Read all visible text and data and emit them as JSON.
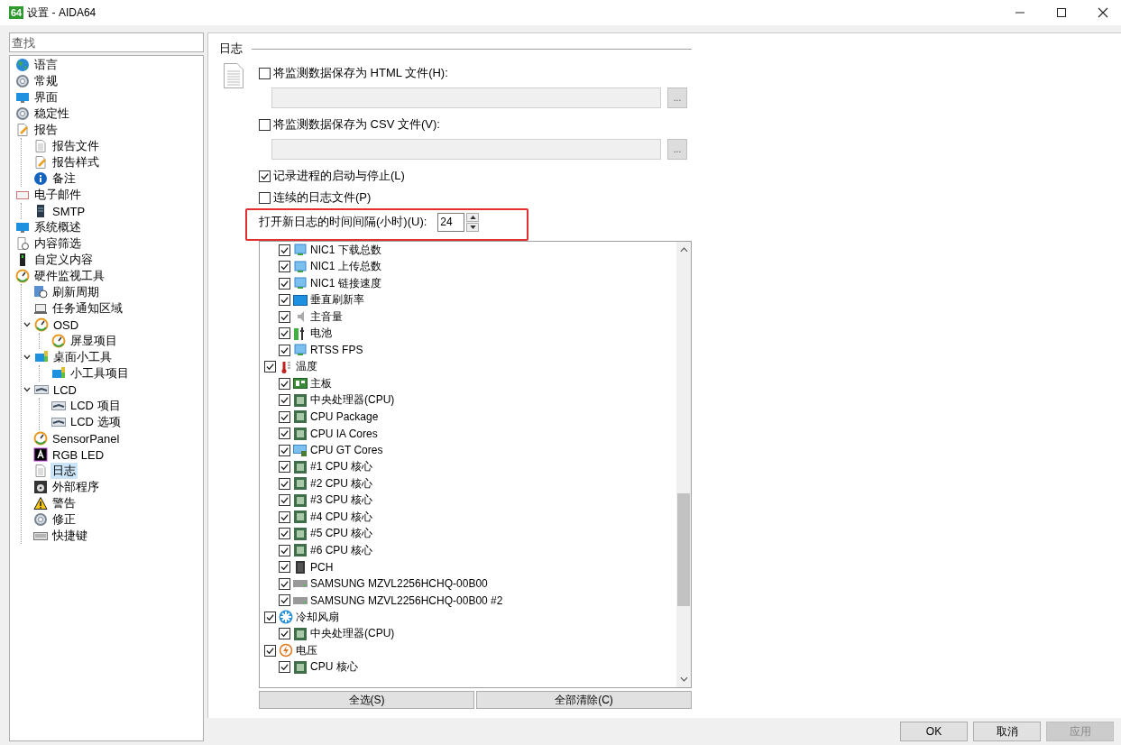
{
  "window": {
    "title": "设置 - AIDA64",
    "app_badge": "64"
  },
  "sidebar": {
    "search": {
      "placeholder": "查找"
    },
    "items": [
      {
        "label": "语言",
        "kind": "globe",
        "selected": false
      },
      {
        "label": "常规",
        "kind": "gear",
        "selected": false
      },
      {
        "label": "界面",
        "kind": "monitor",
        "selected": false
      },
      {
        "label": "稳定性",
        "kind": "gear",
        "selected": false
      },
      {
        "label": "报告",
        "kind": "docpen",
        "selected": false,
        "children": [
          {
            "label": "报告文件",
            "kind": "doc",
            "selected": false
          },
          {
            "label": "报告样式",
            "kind": "docpen",
            "selected": false
          },
          {
            "label": "备注",
            "kind": "info",
            "selected": false
          }
        ]
      },
      {
        "label": "电子邮件",
        "kind": "mail",
        "selected": false,
        "children": [
          {
            "label": "SMTP",
            "kind": "server",
            "selected": false
          }
        ]
      },
      {
        "label": "系统概述",
        "kind": "monitor",
        "selected": false
      },
      {
        "label": "内容筛选",
        "kind": "docclock",
        "selected": false
      },
      {
        "label": "自定义内容",
        "kind": "device",
        "selected": false
      },
      {
        "label": "硬件监视工具",
        "kind": "gauge",
        "selected": false,
        "children": [
          {
            "label": "刷新周期",
            "kind": "clock",
            "selected": false
          },
          {
            "label": "任务通知区域",
            "kind": "taskbar",
            "selected": false
          },
          {
            "label": "OSD",
            "kind": "gauge",
            "selected": false,
            "expanded": true,
            "children": [
              {
                "label": "屏显项目",
                "kind": "gauge",
                "selected": false
              }
            ]
          },
          {
            "label": "桌面小工具",
            "kind": "gadget",
            "selected": false,
            "expanded": true,
            "children": [
              {
                "label": "小工具项目",
                "kind": "gadget",
                "selected": false
              }
            ]
          },
          {
            "label": "LCD",
            "kind": "lcd",
            "selected": false,
            "expanded": true,
            "children": [
              {
                "label": "LCD 项目",
                "kind": "lcd",
                "selected": false
              },
              {
                "label": "LCD 选项",
                "kind": "lcd",
                "selected": false
              }
            ]
          },
          {
            "label": "SensorPanel",
            "kind": "gauge",
            "selected": false
          },
          {
            "label": "RGB LED",
            "kind": "rgb",
            "selected": false
          },
          {
            "label": "日志",
            "kind": "doc",
            "selected": true
          },
          {
            "label": "外部程序",
            "kind": "disc",
            "selected": false
          },
          {
            "label": "警告",
            "kind": "warning",
            "selected": false
          },
          {
            "label": "修正",
            "kind": "gear",
            "selected": false
          },
          {
            "label": "快捷键",
            "kind": "keyboard",
            "selected": false
          }
        ]
      }
    ]
  },
  "log_page": {
    "heading": "日志",
    "options": [
      {
        "kind": "file",
        "label": "将监测数据保存为 HTML 文件(H):",
        "checked": false,
        "browse": "..."
      },
      {
        "kind": "file",
        "label": "将监测数据保存为 CSV 文件(V):",
        "checked": false,
        "browse": "..."
      },
      {
        "kind": "check",
        "label": "记录进程的启动与停止(L)",
        "checked": true
      },
      {
        "kind": "check",
        "label": "连续的日志文件(P)",
        "checked": false
      }
    ],
    "interval": {
      "label": "打开新日志的时间间隔(小时)(U):",
      "value": "24"
    },
    "sensor_list": {
      "groups": [
        {
          "children": [
            {
              "label": "NIC1 下载总数",
              "kind": "net",
              "checked": true
            },
            {
              "label": "NIC1 上传总数",
              "kind": "net",
              "checked": true
            },
            {
              "label": "NIC1 链接速度",
              "kind": "net",
              "checked": true
            },
            {
              "label": "垂直刷新率",
              "kind": "screen",
              "checked": true
            },
            {
              "label": "主音量",
              "kind": "speaker",
              "checked": true
            },
            {
              "label": "电池",
              "kind": "battery",
              "checked": true
            },
            {
              "label": "RTSS FPS",
              "kind": "net",
              "checked": true
            }
          ]
        },
        {
          "label": "温度",
          "kind": "thermo",
          "checked": true,
          "children": [
            {
              "label": "主板",
              "kind": "board",
              "checked": true
            },
            {
              "label": "中央处理器(CPU)",
              "kind": "chip",
              "checked": true
            },
            {
              "label": "CPU Package",
              "kind": "chip",
              "checked": true
            },
            {
              "label": "CPU IA Cores",
              "kind": "chip",
              "checked": true
            },
            {
              "label": "CPU GT Cores",
              "kind": "gpu",
              "checked": true
            },
            {
              "label": "#1 CPU 核心",
              "kind": "chip",
              "checked": true
            },
            {
              "label": "#2 CPU 核心",
              "kind": "chip",
              "checked": true
            },
            {
              "label": "#3 CPU 核心",
              "kind": "chip",
              "checked": true
            },
            {
              "label": "#4 CPU 核心",
              "kind": "chip",
              "checked": true
            },
            {
              "label": "#5 CPU 核心",
              "kind": "chip",
              "checked": true
            },
            {
              "label": "#6 CPU 核心",
              "kind": "chip",
              "checked": true
            },
            {
              "label": "PCH",
              "kind": "pch",
              "checked": true
            },
            {
              "label": "SAMSUNG MZVL2256HCHQ-00B00",
              "kind": "drive",
              "checked": true
            },
            {
              "label": "SAMSUNG MZVL2256HCHQ-00B00 #2",
              "kind": "drive",
              "checked": true
            }
          ]
        },
        {
          "label": "冷却风扇",
          "kind": "fan",
          "checked": true,
          "children": [
            {
              "label": "中央处理器(CPU)",
              "kind": "chip",
              "checked": true
            }
          ]
        },
        {
          "label": "电压",
          "kind": "bolt",
          "checked": true,
          "children": [
            {
              "label": "CPU 核心",
              "kind": "chip",
              "checked": true
            }
          ]
        }
      ]
    },
    "list_buttons": [
      "全选(S)",
      "全部清除(C)"
    ]
  },
  "dialog_buttons": [
    {
      "label": "OK",
      "disabled": false
    },
    {
      "label": "取消",
      "disabled": false
    },
    {
      "label": "应用",
      "disabled": true
    }
  ]
}
